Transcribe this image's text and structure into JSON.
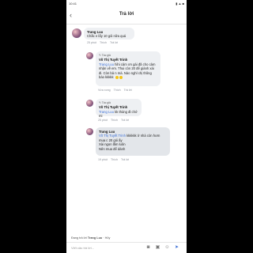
{
  "status": {
    "time": "10:41",
    "icons": "▮ ▲ ■"
  },
  "header": {
    "back": "‹",
    "title": "Trả lời"
  },
  "comment1": {
    "author": "Trang Luu",
    "text": "Chắc e lấy 10 gói nữa quá"
  },
  "meta1": {
    "time": "25 phút",
    "like": "Thích",
    "reply": "Trả lời"
  },
  "comment2": {
    "tag": "Tác giả",
    "author": "Võ Thị Tuyết Trinh",
    "mention": "Trang Luu",
    "text": "hihi cảm ơn gái đã cho cảm nhận về em. Thui còn 20 để giành xài đi. Còn bả n mà. Nào nghỉ chị thông báo kkkkk"
  },
  "meta2": {
    "time": "Vừa xong",
    "like": "Thích",
    "reply": "Trả lời"
  },
  "comment3": {
    "tag": "Tác giả",
    "author": "Võ Thị Tuyết Trinh",
    "mention": "Trang Luu",
    "text": "kk thùng đi chớ mi"
  },
  "meta3": {
    "time": "25 phút",
    "like": "Thích",
    "reply": "Trả lời"
  },
  "comment4": {
    "author": "Trang Luu",
    "mention": "Võ Thị Tuyết Trinh",
    "text": "kkkkkk ở nhà còn hưm mua c 20 gói ấy",
    "line2": "Xài ngon lắm luôn",
    "line3": "Nên mua để dành"
  },
  "meta4": {
    "time": "19 phút",
    "like": "Thích",
    "reply": "Trả lời"
  },
  "replying": {
    "prefix": "Đang trả lời",
    "name": "Trang Luu",
    "cancel": "· Hủy"
  },
  "input": {
    "placeholder": "Viết câu trả lời..."
  }
}
